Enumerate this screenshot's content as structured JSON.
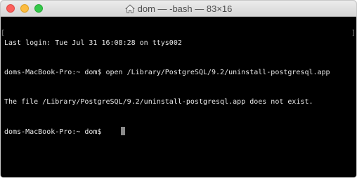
{
  "window": {
    "title": "dom — -bash — 83×16",
    "title_icon": "home-icon"
  },
  "terminal": {
    "lines": [
      "Last login: Tue Jul 31 16:08:28 on ttys002",
      "doms-MacBook-Pro:~ dom$ open /Library/PostgreSQL/9.2/uninstall-postgresql.app",
      "The file /Library/PostgreSQL/9.2/uninstall-postgresql.app does not exist.",
      "doms-MacBook-Pro:~ dom$"
    ],
    "colors": {
      "background": "#000000",
      "text": "#e8e8e8",
      "cursor": "#8a8a8a"
    }
  }
}
